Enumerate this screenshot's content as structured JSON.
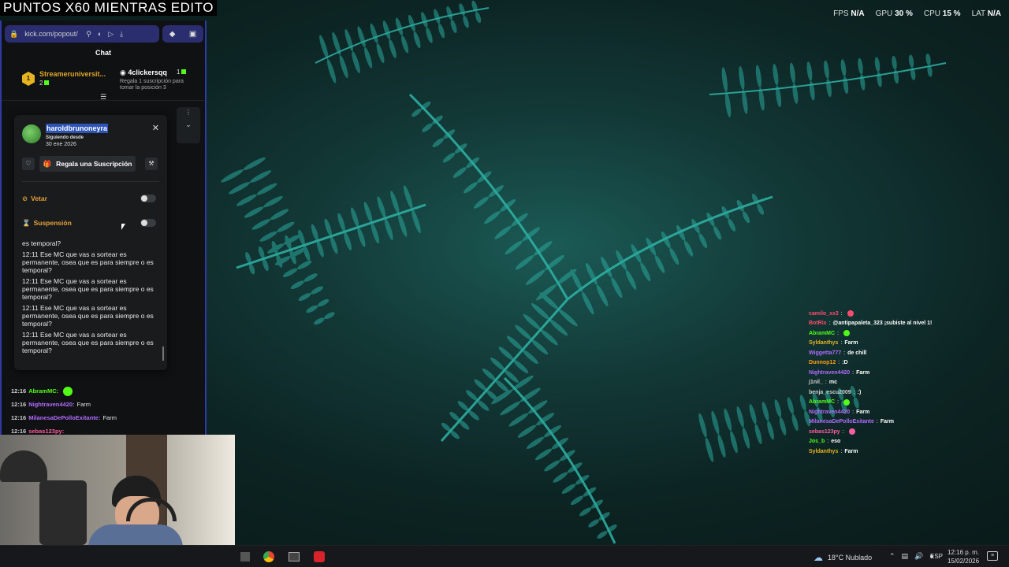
{
  "stream_title": "PUNTOS X60 MIENTRAS EDITO",
  "perf": {
    "fps_label": "FPS",
    "fps_value": "N/A",
    "gpu_label": "GPU",
    "gpu_value": "30 %",
    "cpu_label": "CPU",
    "cpu_value": "15 %",
    "lat_label": "LAT",
    "lat_value": "N/A"
  },
  "browser": {
    "url": "kick.com/popout/"
  },
  "chat": {
    "header": "Chat",
    "leaderboard": {
      "rank": "1",
      "first_name": "Streameruniversit...",
      "first_count": "2",
      "second_name": "4clickersqq",
      "second_count": "1",
      "hint": "Regala 1 suscripción para tomar la posición 3"
    }
  },
  "usercard": {
    "username": "haroldbrunoneyra",
    "following_label": "Siguiendo desde",
    "following_date": "30 ene 2026",
    "gift_label": "Regala una Suscripción",
    "ban_label": "Vetar",
    "timeout_label": "Suspensión",
    "history": [
      "es temporal?",
      "12:11 Ese MC que vas a sortear es permanente, osea que es para siempre o es temporal?",
      "12:11 Ese MC que vas a sortear es permanente, osea que es para siempre o es temporal?",
      "12:11 Ese MC que vas a sortear es permanente, osea que es para siempre o es temporal?",
      "12:11 Ese MC que vas a sortear es permanente, osea que es para siempre o es temporal?"
    ]
  },
  "chat_lines": [
    {
      "time": "12:16",
      "user": "AbramMC:",
      "color": "#53fc18",
      "msg": ""
    },
    {
      "time": "12:16",
      "user": "Nightraven4420:",
      "color": "#b26bff",
      "msg": "Farm"
    },
    {
      "time": "12:16",
      "user": "MilanesaDePolloExitante:",
      "color": "#b26bff",
      "msg": "Farm"
    },
    {
      "time": "12:16",
      "user": "sebas123py:",
      "color": "#ff5ea0",
      "msg": ""
    }
  ],
  "overlay_chat": [
    {
      "user": "camilo_xx3",
      "color": "#ff4b6e",
      "msg": ""
    },
    {
      "user": "BotRix",
      "color": "#ff4b6e",
      "msg": "@antipapaleta_323 ¡subiste al nivel 1!"
    },
    {
      "user": "AbramMC",
      "color": "#53fc18",
      "msg": ""
    },
    {
      "user": "Syldanthys",
      "color": "#e6b422",
      "msg": "Farm"
    },
    {
      "user": "Wiggetta777",
      "color": "#b26bff",
      "msg": "de chill"
    },
    {
      "user": "Dunnop12",
      "color": "#ff9f1a",
      "msg": ":D"
    },
    {
      "user": "Nightraven4420",
      "color": "#b26bff",
      "msg": "Farm"
    },
    {
      "user": "j1nil_",
      "color": "#cfcfcf",
      "msg": "mc"
    },
    {
      "user": "benja_escu2009",
      "color": "#cfcfcf",
      "msg": ":)"
    },
    {
      "user": "AbramMC",
      "color": "#53fc18",
      "msg": ""
    },
    {
      "user": "Nightraven4420",
      "color": "#b26bff",
      "msg": "Farm"
    },
    {
      "user": "MilanesaDePolloExitante",
      "color": "#b26bff",
      "msg": "Farm"
    },
    {
      "user": "sebas123py",
      "color": "#ff5ea0",
      "msg": ""
    },
    {
      "user": "Jos_b",
      "color": "#53fc18",
      "msg": "eso"
    },
    {
      "user": "Syldanthys",
      "color": "#e6b422",
      "msg": "Farm"
    }
  ],
  "taskbar": {
    "weather": "18°C  Nublado",
    "lang": "ESP",
    "time": "12:16 p. m.",
    "date": "15/02/2026"
  }
}
